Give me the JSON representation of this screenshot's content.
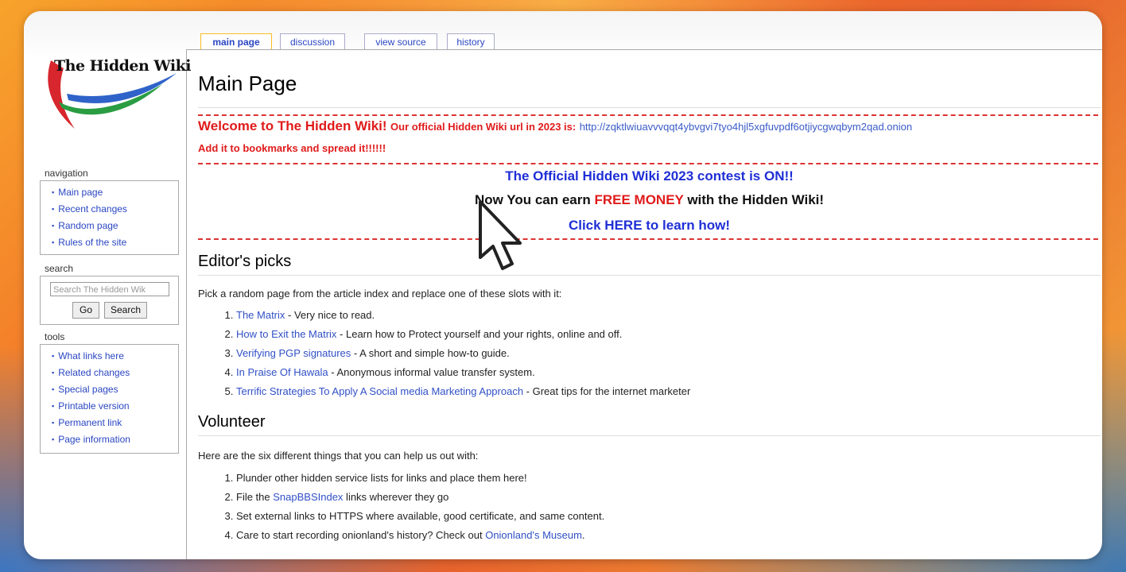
{
  "tabs": [
    {
      "label": "main page",
      "active": true
    },
    {
      "label": "discussion"
    },
    {
      "label": "view source"
    },
    {
      "label": "history"
    }
  ],
  "logo": {
    "text": "The Hidden Wiki"
  },
  "navigation": {
    "title": "navigation",
    "items": [
      "Main page",
      "Recent changes",
      "Random page",
      "Rules of the site"
    ]
  },
  "search": {
    "title": "search",
    "placeholder": "Search The Hidden Wik",
    "go_label": "Go",
    "search_label": "Search"
  },
  "tools": {
    "title": "tools",
    "items": [
      "What links here",
      "Related changes",
      "Special pages",
      "Printable version",
      "Permanent link",
      "Page information"
    ]
  },
  "page": {
    "title": "Main Page",
    "welcome_big": "Welcome to The Hidden Wiki!",
    "welcome_small": "Our official Hidden Wiki url in 2023 is:",
    "url": "http://zqktlwiuavvvqqt4ybvgvi7tyo4hjl5xgfuvpdf6otjiycgwqbym2qad.onion",
    "bookmark": "Add it to bookmarks and spread it!!!!!!",
    "contest": "The Official Hidden Wiki 2023 contest is ON!!",
    "earn_prefix": "Now You can earn",
    "earn_highlight": "FREE MONEY",
    "earn_suffix": "with the Hidden Wiki!",
    "click_here": "Click HERE to learn how!",
    "editors_title": "Editor's picks",
    "editors_intro": "Pick a random page from the article index and replace one of these slots with it:",
    "editors_items": [
      {
        "link": "The Matrix",
        "text": " - Very nice to read."
      },
      {
        "link": "How to Exit the Matrix",
        "text": " - Learn how to Protect yourself and your rights, online and off."
      },
      {
        "link": "Verifying PGP signatures",
        "text": " - A short and simple how-to guide."
      },
      {
        "link": "In Praise Of Hawala",
        "text": " - Anonymous informal value transfer system."
      },
      {
        "link": "Terrific Strategies To Apply A Social media Marketing Approach",
        "text": " - Great tips for the internet marketer"
      }
    ],
    "volunteer_title": "Volunteer",
    "volunteer_intro": "Here are the six different things that you can help us out with:",
    "volunteer_items": [
      {
        "pre": "Plunder other hidden service lists for links and place them here!",
        "link": "",
        "post": ""
      },
      {
        "pre": "File the ",
        "link": "SnapBBSIndex",
        "post": " links wherever they go"
      },
      {
        "pre": "Set external links to HTTPS where available, good certificate, and same content.",
        "link": "",
        "post": ""
      },
      {
        "pre": "Care to start recording onionland's history? Check out ",
        "link": "Onionland's Museum",
        "post": "."
      }
    ]
  },
  "colors": {
    "accent_red": "#e01b1b",
    "link_blue": "#3150c6",
    "headline_blue": "#1f2fd6"
  }
}
